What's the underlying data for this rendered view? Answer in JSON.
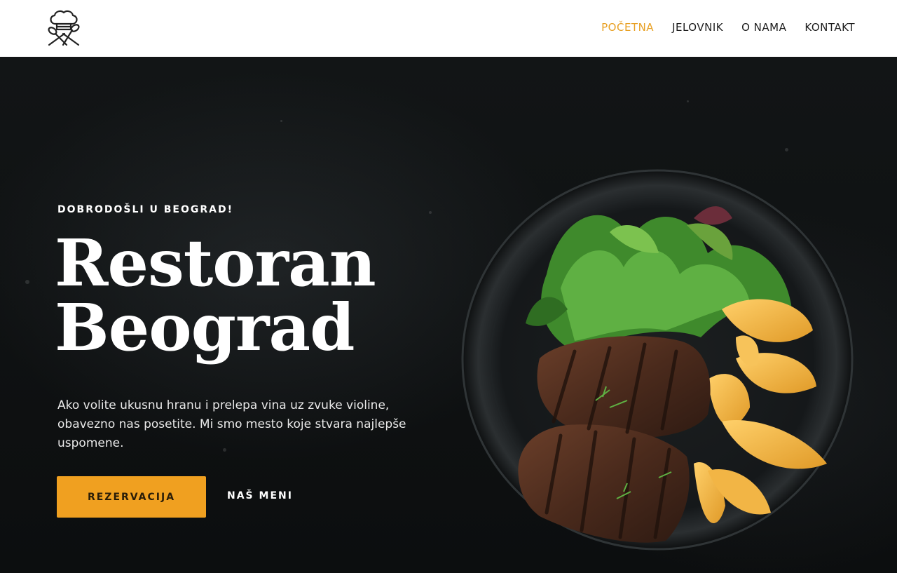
{
  "nav": {
    "items": [
      {
        "label": "POČETNA",
        "active": true
      },
      {
        "label": "JELOVNIK",
        "active": false
      },
      {
        "label": "O NAMA",
        "active": false
      },
      {
        "label": "KONTAKT",
        "active": false
      }
    ]
  },
  "logo": {
    "icon": "chef-hat-utensils-icon"
  },
  "hero": {
    "kicker": "DOBRODOŠLI U BEOGRAD!",
    "title_line1": "Restoran",
    "title_line2": "Beograd",
    "description": "Ako volite ukusnu hranu i prelepa vina uz zvuke violine, obavezno nas posetite. Mi smo mesto koje stvara najlepše uspomene.",
    "primary_button": "REZERVACIJA",
    "secondary_button": "NAŠ MENI",
    "image": "steak-plate-with-salad-and-potatoes"
  },
  "colors": {
    "accent": "#f0a020",
    "nav_active": "#e8a023",
    "hero_background": "#0d0f10"
  }
}
